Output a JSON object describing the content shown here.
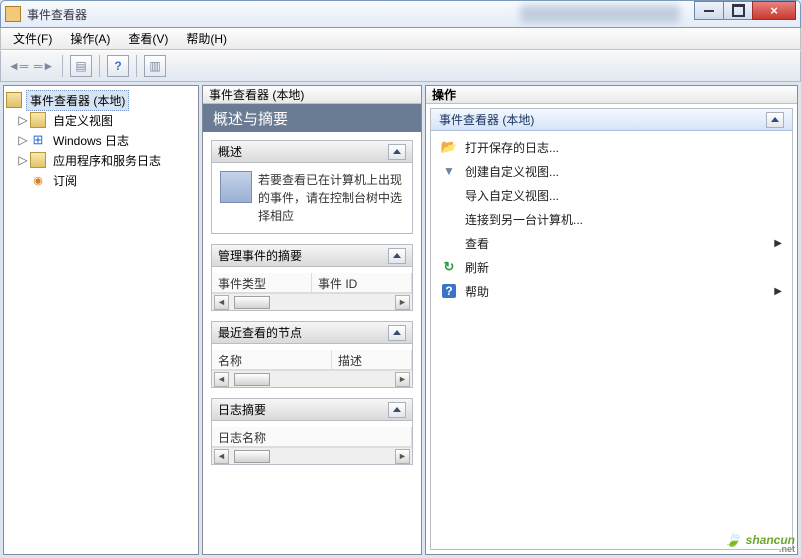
{
  "window": {
    "title": "事件查看器"
  },
  "menu": {
    "file": "文件(F)",
    "action": "操作(A)",
    "view": "查看(V)",
    "help": "帮助(H)"
  },
  "tree": {
    "root": "事件查看器 (本地)",
    "n1": "自定义视图",
    "n2": "Windows 日志",
    "n3": "应用程序和服务日志",
    "n4": "订阅"
  },
  "mid": {
    "pane_title": "事件查看器 (本地)",
    "subtitle": "概述与摘要",
    "sect1": {
      "title": "概述",
      "body": "若要查看已在计算机上出现的事件，请在控制台树中选择相应"
    },
    "sect2": {
      "title": "管理事件的摘要",
      "col1": "事件类型",
      "col2": "事件 ID"
    },
    "sect3": {
      "title": "最近查看的节点",
      "col1": "名称",
      "col2": "描述"
    },
    "sect4": {
      "title": "日志摘要",
      "col1": "日志名称"
    }
  },
  "right": {
    "title": "操作",
    "panel_title": "事件查看器 (本地)",
    "a1": "打开保存的日志...",
    "a2": "创建自定义视图...",
    "a3": "导入自定义视图...",
    "a4": "连接到另一台计算机...",
    "a5": "查看",
    "a6": "刷新",
    "a7": "帮助"
  },
  "watermark": {
    "text": "shancun",
    "sub": ".net"
  }
}
